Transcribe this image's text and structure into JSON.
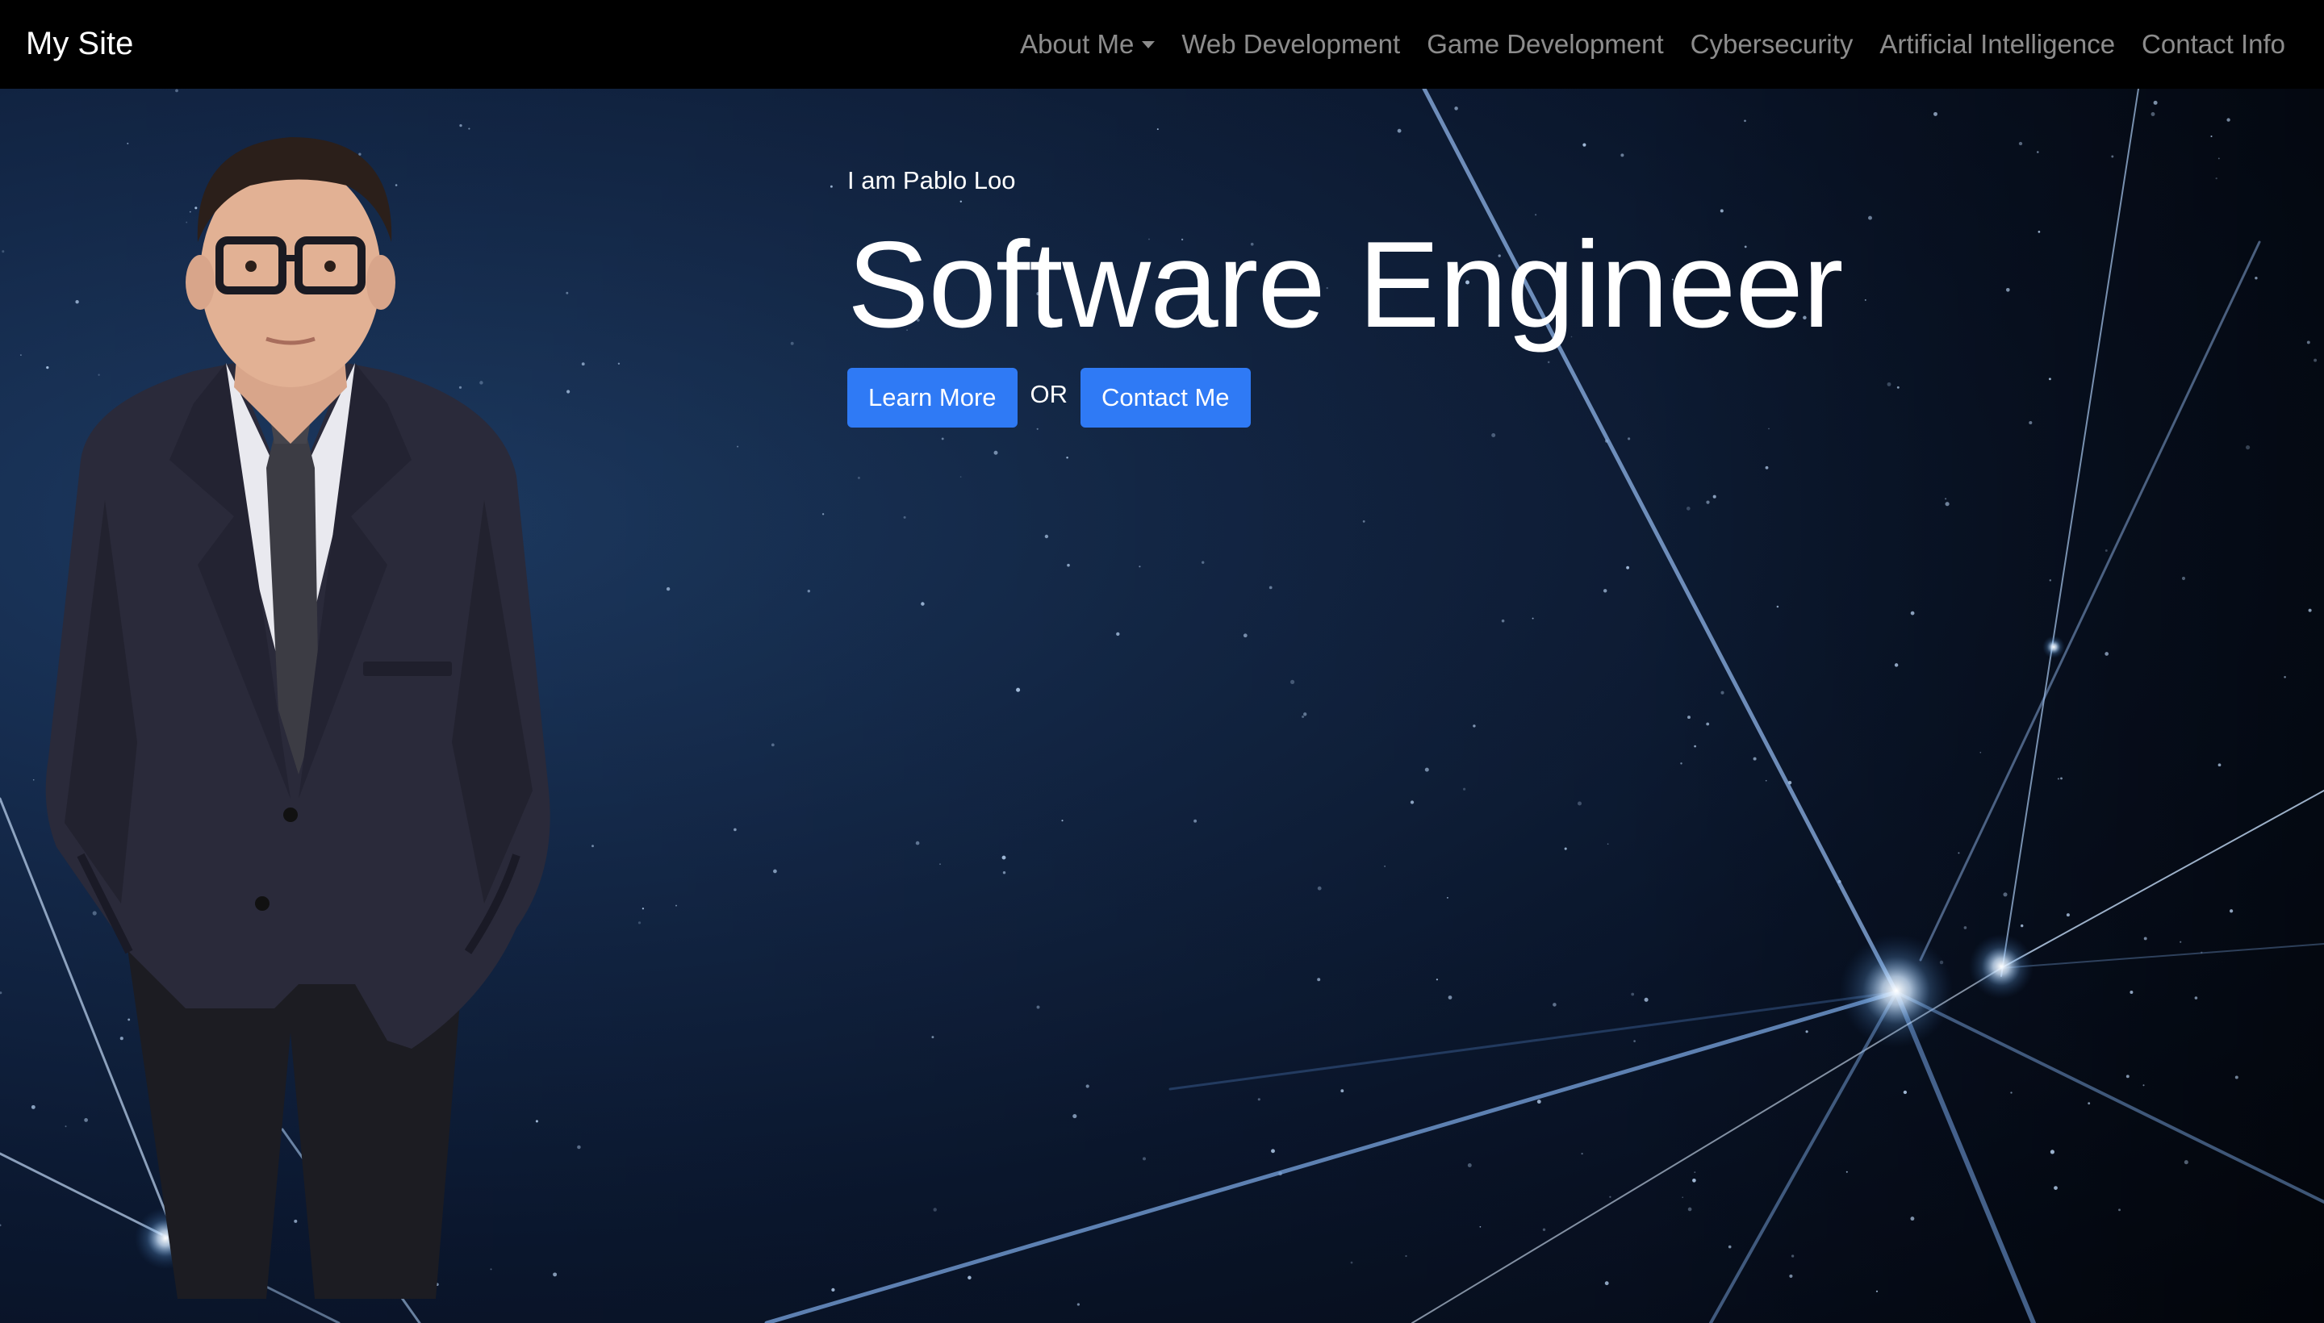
{
  "navbar": {
    "brand": "My Site",
    "links": [
      {
        "label": "About Me",
        "dropdown": true
      },
      {
        "label": "Web Development"
      },
      {
        "label": "Game Development"
      },
      {
        "label": "Cybersecurity"
      },
      {
        "label": "Artificial Intelligence"
      },
      {
        "label": "Contact Info"
      }
    ]
  },
  "hero": {
    "intro": "I am Pablo Loo",
    "headline": "Software Engineer",
    "learn_more_label": "Learn More",
    "or_label": "OR",
    "contact_label": "Contact Me"
  },
  "colors": {
    "navbar_bg": "#000000",
    "button_bg": "#2f7af5",
    "nav_link": "rgba(255,255,255,0.55)",
    "hero_bg": "#0b1830"
  },
  "icons": {
    "dropdown": "caret-down-icon"
  }
}
